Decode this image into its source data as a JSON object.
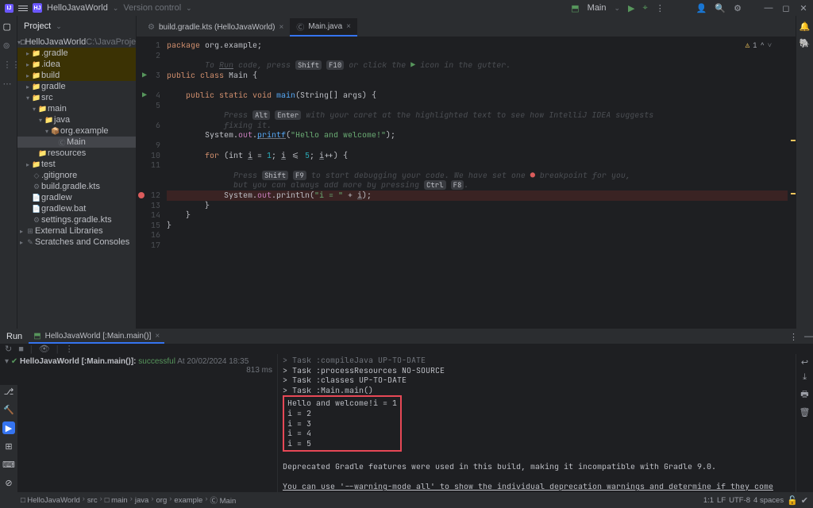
{
  "titlebar": {
    "project": "HelloJavaWorld",
    "vcs": "Version control",
    "run_config": "Main"
  },
  "sidebar": {
    "title": "Project",
    "tree": [
      {
        "depth": 0,
        "chev": "▾",
        "icon": "□",
        "cls": "folder-n",
        "label": "HelloJavaWorld",
        "suffix": " C:\\JavaProject",
        "hl": false
      },
      {
        "depth": 1,
        "chev": "▸",
        "icon": "📁",
        "cls": "folder-a",
        "label": ".gradle",
        "hl": true
      },
      {
        "depth": 1,
        "chev": "▸",
        "icon": "📁",
        "cls": "folder-a",
        "label": ".idea",
        "hl": true
      },
      {
        "depth": 1,
        "chev": "▸",
        "icon": "📁",
        "cls": "folder-a",
        "label": "build",
        "hl": true
      },
      {
        "depth": 1,
        "chev": "▸",
        "icon": "📁",
        "cls": "folder-n",
        "label": "gradle"
      },
      {
        "depth": 1,
        "chev": "▾",
        "icon": "📁",
        "cls": "folder-n",
        "label": "src"
      },
      {
        "depth": 2,
        "chev": "▾",
        "icon": "📁",
        "cls": "folder-n",
        "label": "main"
      },
      {
        "depth": 3,
        "chev": "▾",
        "icon": "📁",
        "cls": "folder-n",
        "label": "java"
      },
      {
        "depth": 4,
        "chev": "▾",
        "icon": "📦",
        "cls": "folder-n",
        "label": "org.example"
      },
      {
        "depth": 5,
        "chev": "",
        "icon": "Ⓒ",
        "cls": "file-i",
        "label": "Main",
        "sel": true
      },
      {
        "depth": 2,
        "chev": "",
        "icon": "📁",
        "cls": "folder-n",
        "label": "resources"
      },
      {
        "depth": 1,
        "chev": "▸",
        "icon": "📁",
        "cls": "folder-n",
        "label": "test"
      },
      {
        "depth": 1,
        "chev": "",
        "icon": "◇",
        "cls": "file-i",
        "label": ".gitignore"
      },
      {
        "depth": 1,
        "chev": "",
        "icon": "⚙",
        "cls": "file-i",
        "label": "build.gradle.kts"
      },
      {
        "depth": 1,
        "chev": "",
        "icon": "📄",
        "cls": "file-i",
        "label": "gradlew"
      },
      {
        "depth": 1,
        "chev": "",
        "icon": "📄",
        "cls": "file-i",
        "label": "gradlew.bat"
      },
      {
        "depth": 1,
        "chev": "",
        "icon": "⚙",
        "cls": "file-i",
        "label": "settings.gradle.kts"
      },
      {
        "depth": 0,
        "chev": "▸",
        "icon": "⊞",
        "cls": "file-i",
        "label": "External Libraries"
      },
      {
        "depth": 0,
        "chev": "▸",
        "icon": "✎",
        "cls": "file-i",
        "label": "Scratches and Consoles"
      }
    ]
  },
  "tabs": [
    {
      "icon": "⚙",
      "label": "build.gradle.kts (HelloJavaWorld)",
      "active": false
    },
    {
      "icon": "Ⓒ",
      "label": "Main.java",
      "active": true
    }
  ],
  "inspection": {
    "warn": "1",
    "up": "^",
    "down": "˅"
  },
  "gutter": {
    "lines": [
      "1",
      "2",
      "",
      "3",
      "",
      "4",
      "5",
      "",
      "6",
      "",
      "9",
      "10",
      "11",
      "",
      "",
      "12",
      "13",
      "14",
      "15",
      "16",
      "17"
    ],
    "runmarks": [
      3,
      5
    ],
    "breakpoint": 15
  },
  "code": {
    "l1a": "package ",
    "l1b": "org.example",
    "hint1a": "        To ",
    "hint1b": "Run",
    "hint1c": " code, press ",
    "hint1d": "Shift",
    "hint1e": "F10",
    "hint1f": " or click the ",
    "hint1g": "▶",
    "hint1h": " icon in the gutter.",
    "l3": "public class ",
    "l3b": "Main",
    " l3c": " {",
    "l4a": "    public static void ",
    "l4b": "main",
    "l4c": "(String[] ",
    "l4d": "args",
    "l4e": ") {",
    "hint2a": "            Press ",
    "hint2b": "Alt",
    "hint2c": "Enter",
    "hint2d": " with your caret at the highlighted text to see how IntelliJ IDEA suggests",
    "hint2e": "            fixing it.",
    "l6a": "        System.",
    "l6b": "out",
    "l6c": ".",
    "l6d": "printf",
    "l6e": "(",
    "l6f": "\"Hello and welcome!\"",
    "l6g": ");",
    "l8a": "        for ",
    "l8b": "(int ",
    "l8c": "i",
    "l8d": " = ",
    "l8e": "1",
    "l8f": "; ",
    "l8g": "i",
    "l8h": " <= ",
    "l8i": "5",
    "l8j": "; ",
    "l8k": "i",
    "l8l": "++) {",
    "hint3a": "              Press ",
    "hint3b": "Shift",
    "hint3c": "F9",
    "hint3d": " to start debugging your code. We have set one ",
    "hint3e": " breakpoint for you,",
    "hint3f": "              but you can always add more by pressing ",
    "hint3g": "Ctrl",
    "hint3h": "F8",
    "l10a": "            System.",
    "l10b": "out",
    "l10c": ".println(",
    "l10d": "\"i = \"",
    "l10e": " + ",
    "l10f": "i",
    "l10g": ");",
    "l11": "        }",
    "l12": "    }",
    "l13": "}"
  },
  "run_panel": {
    "title": "Run",
    "tab": "HelloJavaWorld [:Main.main()]",
    "task": {
      "name": "HelloJavaWorld [:Main.main()]:",
      "status": "successful",
      "time": "At 20/02/2024 18:35",
      "dur": "813 ms"
    },
    "out": [
      "> Task :compileJava UP-TO-DATE",
      "> Task :processResources NO-SOURCE",
      "> Task :classes UP-TO-DATE",
      "",
      "> Task :Main.main()"
    ],
    "boxed": [
      "Hello and welcome!i = 1",
      "i = 2",
      "i = 3",
      "i = 4",
      "i = 5"
    ],
    "tail1": "Deprecated Gradle features were used in this build, making it incompatible with Gradle 9.0.",
    "tail2": "You can use '--warning-mode all' to show the individual deprecation warnings and determine if they come from your own scripts or plugins"
  },
  "breadcrumbs": [
    "□ HelloJavaWorld",
    "src",
    "□ main",
    "java",
    "org",
    "example",
    "Ⓒ Main"
  ],
  "status": {
    "pos": "1:1",
    "le": "LF",
    "enc": "UTF-8",
    "indent": "4 spaces"
  }
}
